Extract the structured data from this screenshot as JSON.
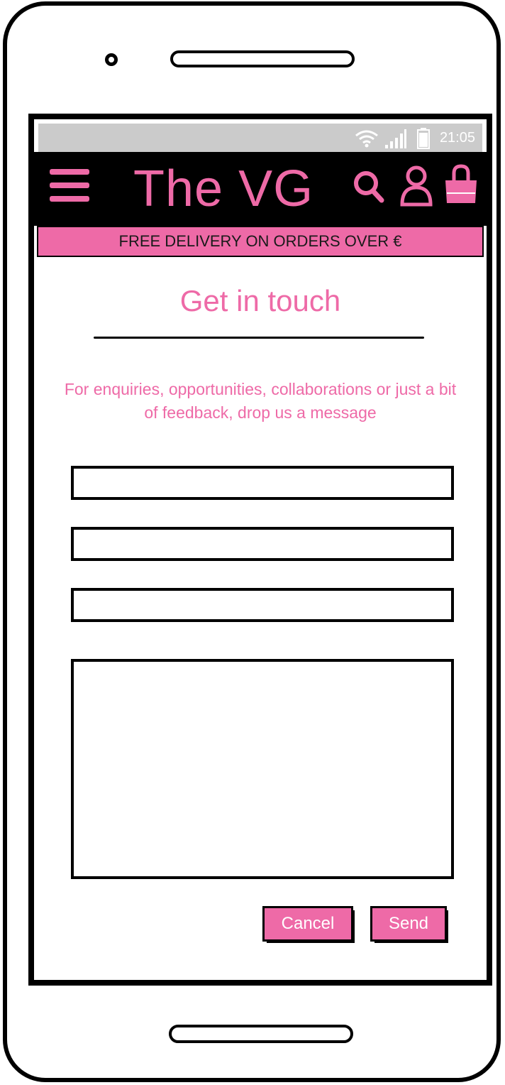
{
  "status_bar": {
    "time": "21:05",
    "icons": [
      "wifi-icon",
      "signal-icon",
      "battery-icon"
    ]
  },
  "header": {
    "brand": "The VG",
    "icons": [
      "menu-icon",
      "search-icon",
      "user-icon",
      "shopping-bag-icon"
    ]
  },
  "banner": {
    "text": "FREE DELIVERY ON ORDERS OVER €"
  },
  "contact": {
    "title": "Get in touch",
    "intro": "For enquiries, opportunities, collaborations or just a bit of feedback, drop us a message",
    "fields": {
      "name": "",
      "email": "",
      "subject": "",
      "message": ""
    },
    "cancel_label": "Cancel",
    "send_label": "Send"
  },
  "colors": {
    "accent": "#ee6aa7",
    "header_bg": "#000000",
    "statusbar_bg": "#cbcbcb"
  }
}
